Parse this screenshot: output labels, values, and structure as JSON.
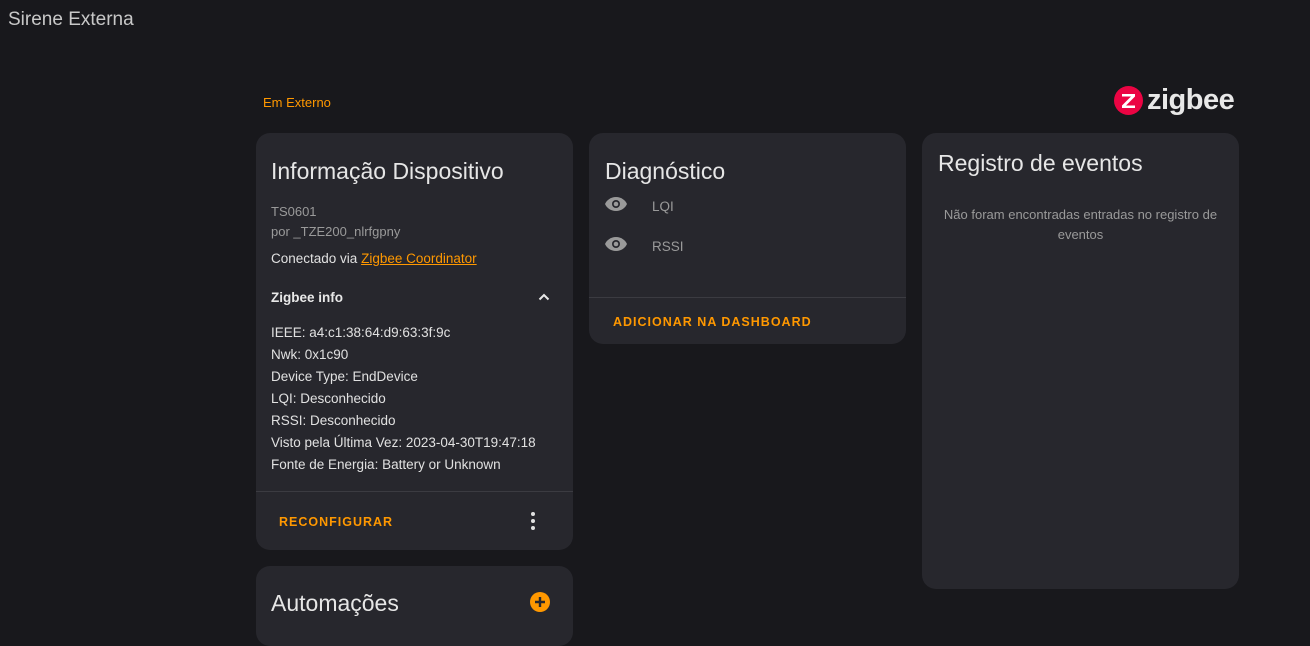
{
  "header": {
    "title": "Sirene Externa"
  },
  "area": {
    "label": "Em Externo"
  },
  "brand": {
    "name": "zigbee",
    "color": "#eb0443"
  },
  "device_info": {
    "title": "Informação Dispositivo",
    "model": "TS0601",
    "manufacturer": "por _TZE200_nlrfgpny",
    "connected_prefix": "Conectado via",
    "connected_link": "Zigbee Coordinator",
    "zigbee_info": {
      "heading": "Zigbee info",
      "lines": [
        "IEEE: a4:c1:38:64:d9:63:3f:9c",
        "Nwk: 0x1c90",
        "Device Type: EndDevice",
        "LQI: Desconhecido",
        "RSSI: Desconhecido",
        "Visto pela Última Vez: 2023-04-30T19:47:18",
        "Fonte de Energia: Battery or Unknown"
      ]
    },
    "reconfigure_label": "RECONFIGURAR"
  },
  "automations": {
    "title": "Automações"
  },
  "diagnostics": {
    "title": "Diagnóstico",
    "items": [
      {
        "label": "LQI",
        "icon": "eye-icon"
      },
      {
        "label": "RSSI",
        "icon": "eye-icon"
      }
    ],
    "add_dashboard_label": "ADICIONAR NA DASHBOARD"
  },
  "logbook": {
    "title": "Registro de eventos",
    "empty_message": "Não foram encontradas entradas no registro de eventos"
  },
  "colors": {
    "accent": "#ff9800",
    "card_bg": "#27272d",
    "page_bg": "#18181c"
  }
}
